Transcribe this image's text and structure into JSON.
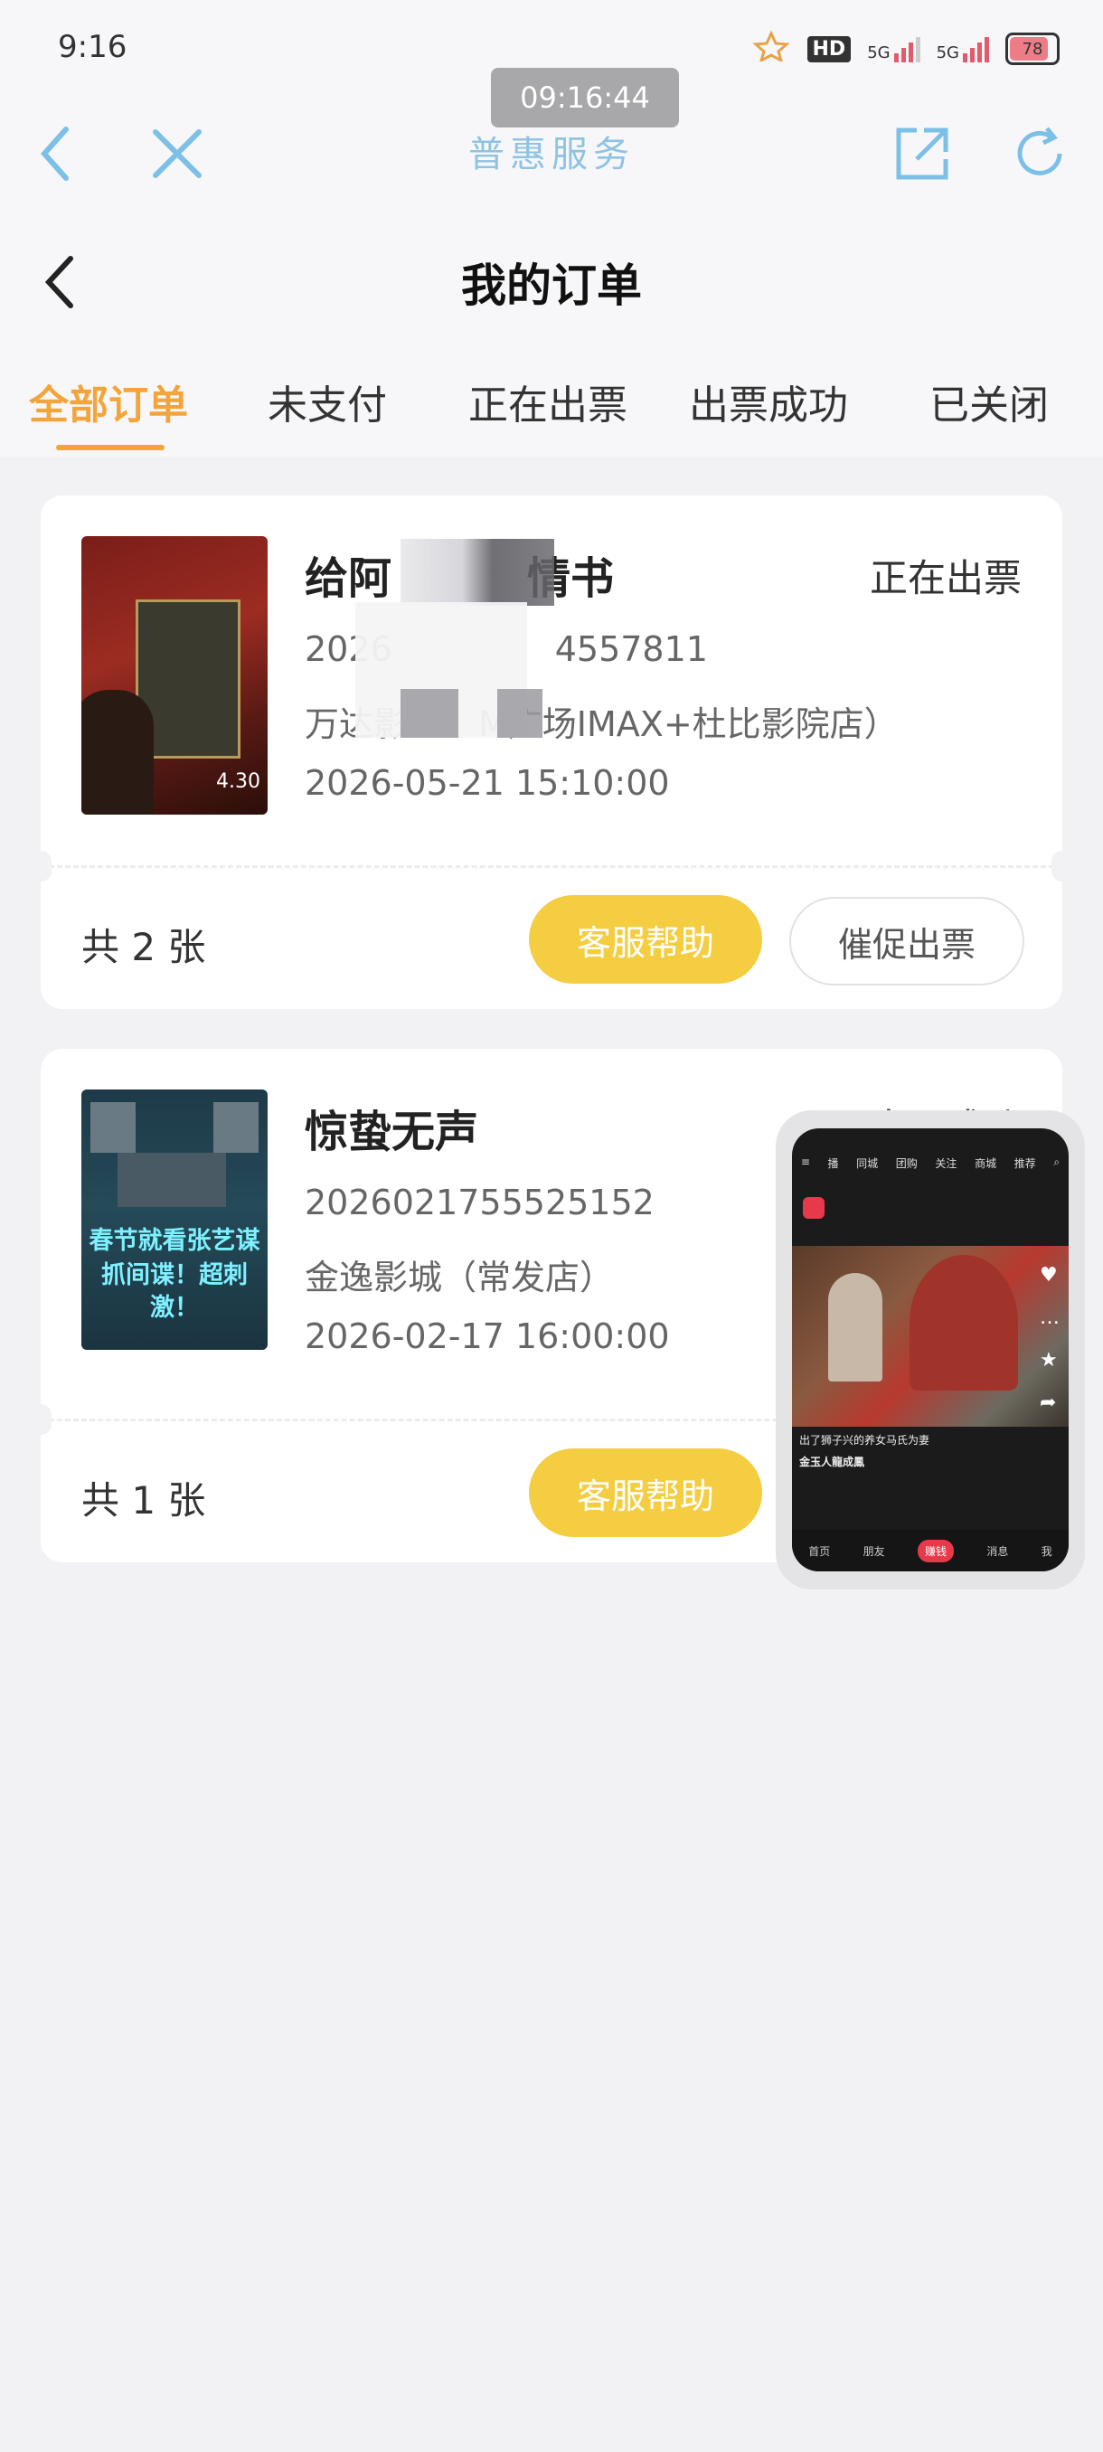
{
  "status_bar": {
    "time": "9:16",
    "hd_label": "HD",
    "net_label": "5G",
    "battery": "78"
  },
  "time_bubble": "09:16:44",
  "browser": {
    "title": "普惠服务"
  },
  "page": {
    "title": "我的订单"
  },
  "tabs": [
    {
      "label": "全部订单",
      "active": true
    },
    {
      "label": "未支付",
      "active": false
    },
    {
      "label": "正在出票",
      "active": false
    },
    {
      "label": "出票成功",
      "active": false
    },
    {
      "label": "已关闭",
      "active": false
    }
  ],
  "orders": [
    {
      "title": "给阿",
      "title_tail": "情书",
      "status": "正在出票",
      "order_no_head": "2026",
      "order_no_tail": "4557811",
      "cinema_head": "万达影",
      "cinema_tail": "M广场IMAX+杜比影院店）",
      "showtime": "2026-05-21 15:10:00",
      "count": "共 2 张",
      "help_label": "客服帮助",
      "urge_label": "催促出票",
      "poster_date": "4.30"
    },
    {
      "title": "惊蛰无声",
      "status": "出票成功",
      "order_no": "2026021755525152",
      "cinema": "金逸影城（常发店）",
      "showtime": "2026-02-17 16:00:00",
      "count": "共 1 张",
      "help_label": "客服帮助",
      "poster_text_1": "春节就看张艺谋",
      "poster_text_2": "抓间谍！超刺激！"
    }
  ],
  "mini_window": {
    "nav": [
      "播",
      "同城",
      "团购",
      "关注",
      "商城",
      "推荐"
    ],
    "caption_1": "出了狮子兴的养女马氏为妻",
    "caption_2": "金玉人龍成鳳",
    "bottom": [
      "首页",
      "朋友",
      "赚钱",
      "消息",
      "我"
    ]
  },
  "colors": {
    "accent": "#f3a43a",
    "help_button": "#f4cd40",
    "browser_title": "#8fc3e3"
  }
}
